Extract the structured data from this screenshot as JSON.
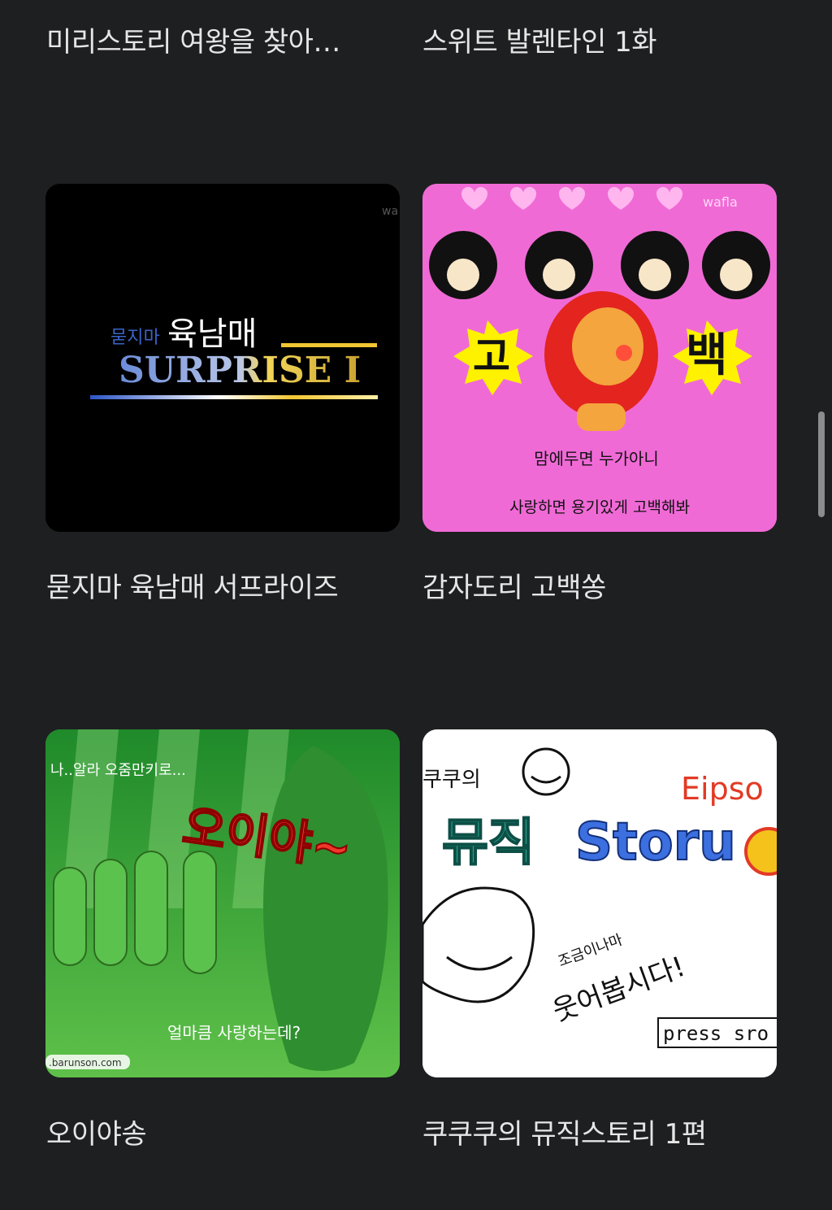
{
  "items": [
    {
      "title": "미리스토리 여왕을 찾아…"
    },
    {
      "title": "스위트 발렌타인 1화"
    },
    {
      "title": "묻지마 육남매 서프라이즈",
      "thumb_text": {
        "small": "묻지마",
        "big": "육남매",
        "latin": "SURPRISE I",
        "watermark": "wa"
      }
    },
    {
      "title": "감자도리 고백쏭",
      "thumb_text": {
        "left": "고",
        "right": "백",
        "line1": "맘에두면 누가아니",
        "line2": "사랑하면 용기있게 고백해봐",
        "watermark": "wafla"
      }
    },
    {
      "title": "오이야송",
      "thumb_text": {
        "big": "오이야~",
        "top": "나..알라 오줌만키로...",
        "bottom": "얼마큼 사랑하는데?",
        "site": ".barunson.com"
      }
    },
    {
      "title": "쿠쿠쿠의 뮤직스토리 1편",
      "thumb_text": {
        "top": "쿠쿠의",
        "title_ko": "뮤직",
        "title_en": "Storu",
        "episode": "Eipso",
        "line1": "조금이나마",
        "line2": "웃어봅시다!",
        "press": "press sro"
      }
    }
  ],
  "colors": {
    "background": "#1e1f21",
    "title_text": "#e6e6e6",
    "scrollbar": "#8c8c8c"
  },
  "scroll": {
    "thumb": "scrollbar"
  }
}
